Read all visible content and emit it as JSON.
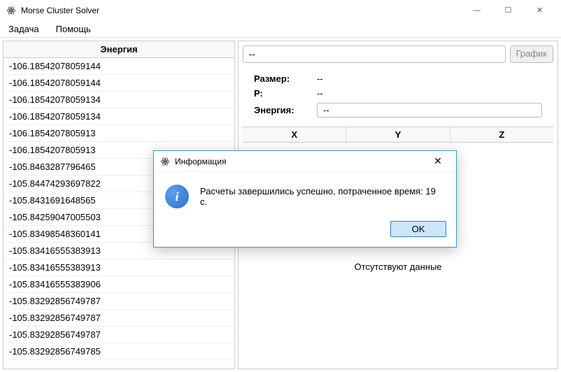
{
  "window": {
    "title": "Morse Cluster Solver"
  },
  "menu": {
    "task": "Задача",
    "help": "Помощь"
  },
  "left": {
    "header": "Энергия",
    "rows": [
      "-106.18542078059144",
      "-106.18542078059144",
      "-106.18542078059134",
      "-106.18542078059134",
      "-106.1854207805913",
      "-106.1854207805913",
      "-105.8463287796465",
      "-105.84474293697822",
      "-105.8431691648565",
      "-105.84259047005503",
      "-105.83498548360141",
      "-105.83416555383913",
      "-105.83416555383913",
      "-105.83416555383906",
      "-105.83292856749787",
      "-105.83292856749787",
      "-105.83292856749787",
      "-105.83292856749785"
    ]
  },
  "right": {
    "dash": "--",
    "graphic": "График",
    "size_label": "Размер:",
    "size_value": "--",
    "p_label": "Р:",
    "p_value": "--",
    "energy_label": "Энергия:",
    "energy_value": "--",
    "col_x": "X",
    "col_y": "Y",
    "col_z": "Z",
    "no_data": "Отсутствуют данные"
  },
  "dialog": {
    "title": "Информация",
    "message": "Расчеты завершились успешно, потраченное время: 19 с.",
    "ok": "OK",
    "info_glyph": "i"
  },
  "win_controls": {
    "min": "—",
    "max": "☐",
    "close": "✕"
  }
}
